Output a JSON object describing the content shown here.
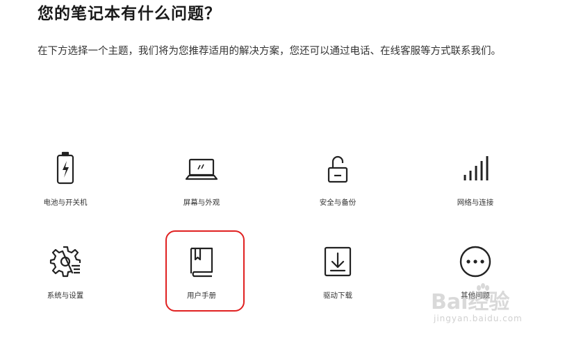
{
  "header": {
    "title": "您的笔记本有什么问题？",
    "intro": "在下方选择一个主题，我们将为您推荐适用的解决方案，您还可以通过电话、在线客服等方式联系我们。"
  },
  "topics": [
    {
      "label": "电池与开关机",
      "icon": "battery-icon"
    },
    {
      "label": "屏幕与外观",
      "icon": "laptop-icon"
    },
    {
      "label": "安全与备份",
      "icon": "unlock-icon"
    },
    {
      "label": "网络与连接",
      "icon": "signal-bars-icon"
    },
    {
      "label": "系统与设置",
      "icon": "gear-icon"
    },
    {
      "label": "用户手册",
      "icon": "book-icon"
    },
    {
      "label": "驱动下载",
      "icon": "download-icon"
    },
    {
      "label": "其他问题",
      "icon": "more-icon"
    }
  ],
  "annotation": {
    "highlighted_topic": "用户手册",
    "highlight_color": "#e02020"
  },
  "watermark": {
    "brand": "Bai经验",
    "url": "jingyan.baidu.com"
  },
  "colors": {
    "icon_stroke": "#222222",
    "text": "#333333"
  }
}
